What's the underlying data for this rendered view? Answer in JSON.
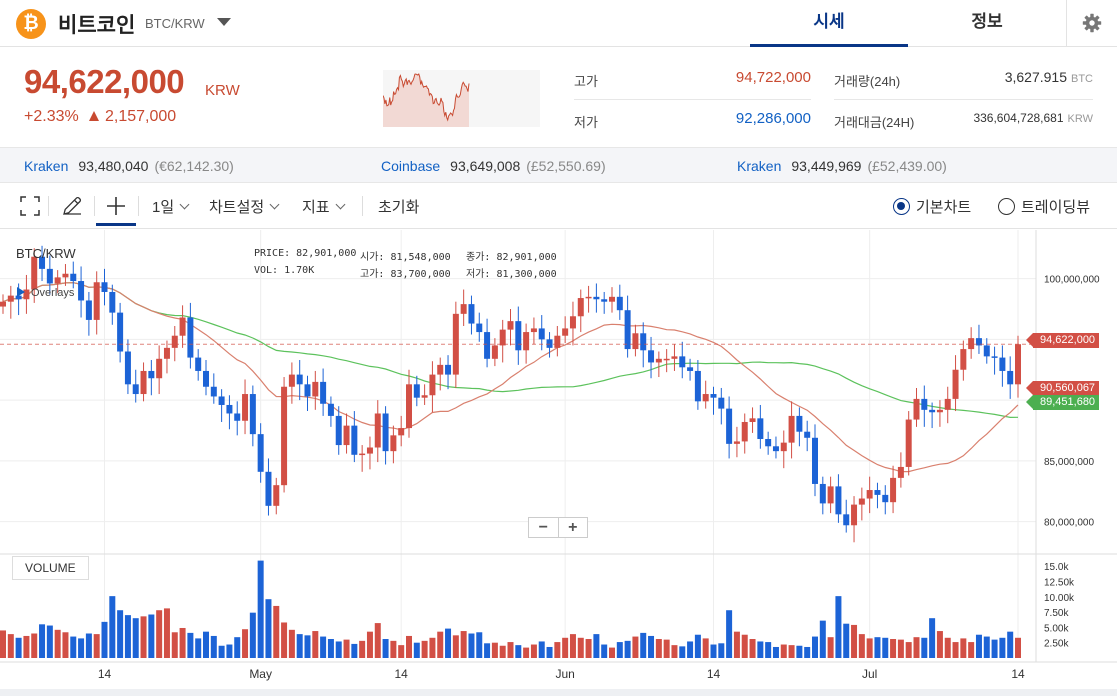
{
  "header": {
    "coin_symbol": "₿",
    "coin_name": "비트코인",
    "pair": "BTC/KRW",
    "tabs": [
      "시세",
      "정보"
    ],
    "active_tab": "시세"
  },
  "price": {
    "current": "94,622,000",
    "unit": "KRW",
    "change_rate": "+2.33%",
    "change_amount": "2,157,000",
    "high_label": "고가",
    "high": "94,722,000",
    "low_label": "저가",
    "low": "92,286,000",
    "volume_label": "거래량(24h)",
    "volume": "3,627.915",
    "volume_unit": "BTC",
    "amount_label": "거래대금(24H)",
    "amount": "336,604,728,681",
    "amount_unit": "KRW"
  },
  "exchanges": [
    {
      "name": "Kraken",
      "price": "93,480,040",
      "sub": "(€62,142.30)"
    },
    {
      "name": "Coinbase",
      "price": "93,649,008",
      "sub": "(£52,550.69)"
    },
    {
      "name": "Kraken",
      "price": "93,449,969",
      "sub": "(£52,439.00)"
    }
  ],
  "toolbar": {
    "interval": "1일",
    "chart_settings": "차트설정",
    "indicators": "지표",
    "reset": "초기화",
    "chart_basic": "기본차트",
    "chart_trading": "트레이딩뷰",
    "selected_chart": "기본차트"
  },
  "chart_overlay": {
    "symbol": "BTC/KRW",
    "overlays": "Overlays",
    "price_label": "PRICE:",
    "price_val": "82,901,000",
    "vol_label": "VOL:",
    "vol_val": "1.70K",
    "open_label": "시가:",
    "open_val": "81,548,000",
    "high_label": "고가:",
    "high_val": "83,700,000",
    "close_label": "종가:",
    "close_val": "82,901,000",
    "low_label": "저가:",
    "low_val": "81,300,000",
    "zoom_out": "−",
    "zoom_in": "+",
    "volume_title": "VOLUME",
    "tag_current": "94,622,000",
    "tag_ma_short": "90,560,067",
    "tag_ma_long": "89,451,680"
  },
  "colors": {
    "up": "#d24f45",
    "down": "#1c63d6",
    "accent": "#093687",
    "ma_short": "#d9806e",
    "ma_long": "#5cc25c"
  },
  "chart_data": {
    "type": "candlestick",
    "price_axis": {
      "ticks": [
        80000000,
        85000000,
        90000000,
        95000000,
        100000000
      ],
      "tick_labels": [
        "80,000,000",
        "85,000,000",
        "",
        "",
        "100,000,000"
      ],
      "range": [
        77500000,
        104000000
      ]
    },
    "volume_axis": {
      "tick_labels": [
        "2.50k",
        "5.00k",
        "7.50k",
        "10.00k",
        "12.50k",
        "15.0k"
      ],
      "range": [
        0,
        16000
      ]
    },
    "x_tick_labels": [
      "14",
      "May",
      "14",
      "Jun",
      "14",
      "Jul",
      "14"
    ],
    "closes": [
      98.1,
      98.6,
      98.3,
      99.1,
      101.8,
      100.8,
      99.6,
      100.1,
      100.4,
      99.8,
      98.2,
      96.6,
      99.7,
      98.9,
      97.2,
      94.0,
      91.3,
      90.5,
      92.4,
      91.8,
      93.4,
      94.3,
      95.3,
      96.8,
      93.5,
      92.4,
      91.1,
      90.3,
      89.6,
      88.9,
      88.3,
      90.5,
      87.2,
      84.1,
      81.3,
      83.0,
      91.1,
      92.1,
      91.3,
      90.3,
      91.5,
      89.7,
      88.7,
      86.3,
      87.9,
      85.5,
      85.6,
      86.1,
      88.9,
      85.8,
      87.1,
      87.7,
      91.3,
      90.2,
      90.4,
      92.1,
      92.9,
      92.1,
      97.1,
      97.9,
      96.3,
      95.6,
      93.4,
      94.5,
      95.8,
      96.5,
      94.1,
      95.6,
      95.9,
      95.0,
      94.3,
      95.3,
      95.9,
      96.9,
      98.4,
      98.5,
      98.3,
      98.1,
      98.5,
      97.4,
      94.2,
      95.5,
      94.1,
      93.1,
      93.4,
      93.4,
      93.6,
      92.7,
      92.4,
      89.9,
      90.5,
      90.2,
      89.3,
      86.4,
      86.6,
      88.2,
      88.5,
      86.8,
      86.2,
      85.8,
      86.5,
      88.7,
      87.4,
      86.9,
      83.1,
      81.5,
      82.9,
      80.6,
      79.7,
      81.4,
      81.9,
      82.6,
      82.2,
      81.6,
      83.6,
      84.5,
      88.4,
      90.1,
      89.2,
      89.0,
      89.2,
      90.1,
      92.5,
      94.2,
      95.1,
      94.5,
      93.6,
      93.5,
      92.4,
      91.3,
      94.6
    ],
    "volumes": [
      4.5,
      3.9,
      3.3,
      3.6,
      4.0,
      5.5,
      5.3,
      4.6,
      4.2,
      3.5,
      3.2,
      4.0,
      3.9,
      5.9,
      10.1,
      7.8,
      7.0,
      6.5,
      6.8,
      7.1,
      7.8,
      8.1,
      4.2,
      4.9,
      4.1,
      3.2,
      4.3,
      3.6,
      2.0,
      2.2,
      3.4,
      4.7,
      7.4,
      15.9,
      9.6,
      8.5,
      5.8,
      4.6,
      3.9,
      3.7,
      4.4,
      3.5,
      3.1,
      2.7,
      3.0,
      2.3,
      2.8,
      4.3,
      5.7,
      3.1,
      2.8,
      2.1,
      3.6,
      2.5,
      2.8,
      3.3,
      4.3,
      4.8,
      3.7,
      4.4,
      4.0,
      4.2,
      2.4,
      2.5,
      2.0,
      2.6,
      2.1,
      1.7,
      2.2,
      2.7,
      1.8,
      2.6,
      3.3,
      3.9,
      3.3,
      3.1,
      3.9,
      2.2,
      1.7,
      2.6,
      2.8,
      3.5,
      4.1,
      3.6,
      3.1,
      3.0,
      2.1,
      1.9,
      2.7,
      3.8,
      3.2,
      2.2,
      2.4,
      7.8,
      4.3,
      3.8,
      3.1,
      2.7,
      2.6,
      1.8,
      2.2,
      2.1,
      2.0,
      1.8,
      3.5,
      6.1,
      3.4,
      10.1,
      5.6,
      5.4,
      3.9,
      3.2,
      3.4,
      3.3,
      3.1,
      3.0,
      2.6,
      3.4,
      3.3,
      6.5,
      4.4,
      3.3,
      2.6,
      3.2,
      2.6,
      3.8,
      3.5,
      3.0,
      3.3,
      4.3,
      3.3
    ]
  }
}
